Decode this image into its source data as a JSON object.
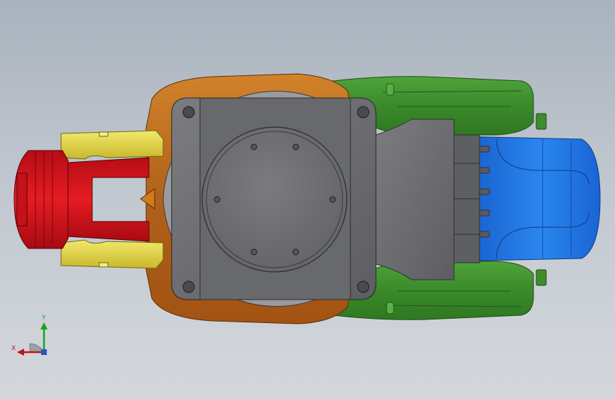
{
  "view": {
    "background_top": "#a9b2be",
    "background_bottom": "#d4d8dd"
  },
  "model": {
    "colors": {
      "gripper": "#d1131c",
      "fork": "#e3d73a",
      "arm": "#b8681b",
      "upper_arm": "#3f8e2d",
      "base_plate": "#6e6f72",
      "motor": "#1f74e0",
      "connector": "#646566"
    }
  },
  "triad": {
    "x_label": "X",
    "y_label": "Y",
    "x_color": "#c0141a",
    "y_color": "#17a31b",
    "z_color": "#2457c9"
  }
}
